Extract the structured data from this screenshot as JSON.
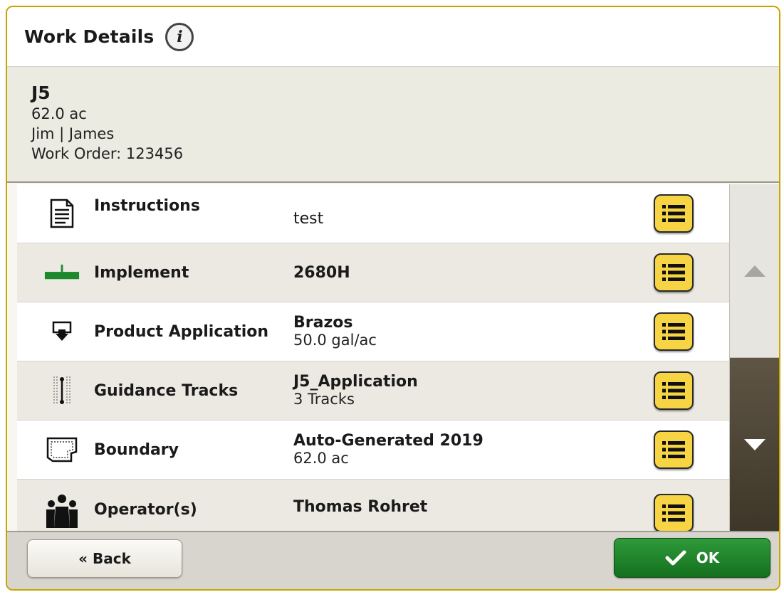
{
  "header": {
    "title": "Work Details",
    "info_icon": "info-icon"
  },
  "summary": {
    "name": "J5",
    "area": "62.0 ac",
    "client_farm": "Jim | James",
    "work_order": "Work Order: 123456"
  },
  "rows": [
    {
      "icon": "instructions-document-icon",
      "label": "Instructions",
      "value": "test",
      "sub": ""
    },
    {
      "icon": "implement-icon",
      "label": "Implement",
      "value": "2680H",
      "sub": ""
    },
    {
      "icon": "product-application-icon",
      "label": "Product Application",
      "value": "Brazos",
      "sub": "50.0 gal/ac"
    },
    {
      "icon": "guidance-tracks-icon",
      "label": "Guidance Tracks",
      "value": "J5_Application",
      "sub": "3 Tracks"
    },
    {
      "icon": "boundary-icon",
      "label": "Boundary",
      "value": "Auto-Generated 2019",
      "sub": "62.0 ac"
    },
    {
      "icon": "operators-icon",
      "label": "Operator(s)",
      "value": "Thomas Rohret",
      "sub": ""
    }
  ],
  "scrollbar": {
    "up": "scroll-up-arrow-icon",
    "down": "scroll-down-arrow-icon"
  },
  "footer": {
    "back_label": "« Back",
    "ok_label": "OK"
  },
  "colors": {
    "accent_yellow": "#f7d443",
    "ok_green": "#1f8a2c",
    "frame_gold": "#c9a400"
  }
}
